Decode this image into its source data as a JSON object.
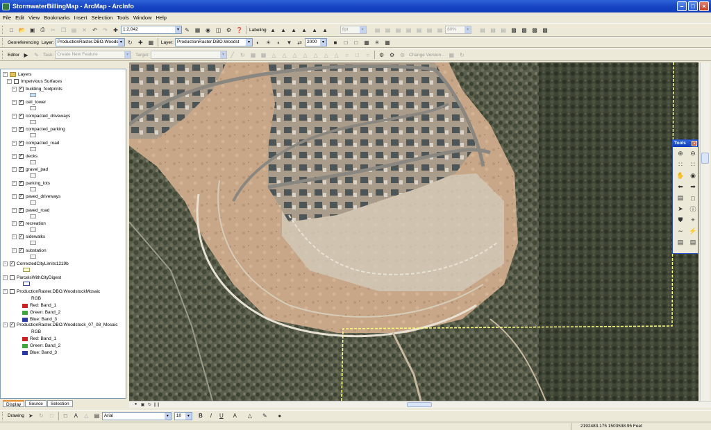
{
  "window": {
    "title": "StormwaterBillingMap - ArcMap - ArcInfo"
  },
  "menu": [
    "File",
    "Edit",
    "View",
    "Bookmarks",
    "Insert",
    "Selection",
    "Tools",
    "Window",
    "Help"
  ],
  "standard_toolbar": {
    "scale": "1:2,042",
    "labeling": "Labeling",
    "font_size": "8pt",
    "zoom": "80%"
  },
  "georef_toolbar": {
    "georeferencing": "Georeferencing",
    "layer_label": "Layer:",
    "layer_value": "ProductionRaster.DBO.Woodstock",
    "layer2_label": "Layer:",
    "layer2_value": "ProductionRaster.DBO.Woodst",
    "value": "2000"
  },
  "editor_toolbar": {
    "editor": "Editor",
    "task_label": "Task:",
    "task_value": "Create New Feature",
    "target_label": "Target:",
    "target_value": "",
    "change_version": "Change Version..."
  },
  "toc": {
    "root": "Layers",
    "group": "Impervious Surfaces",
    "layers": [
      "building_footprints",
      "cell_tower",
      "compacted_driveways",
      "compacted_parking",
      "compacted_road",
      "decks",
      "gravel_pad",
      "parking_lots",
      "paved_driveways",
      "paved_road",
      "recreation",
      "sidewalks",
      "substation"
    ],
    "corrected_limits": "CorrectedCityLimits1219b",
    "parcels": "ParcelsWithCityDigest",
    "raster1": "ProductionRaster.DBO.WoodstockMosaic",
    "raster2": "ProductionRaster.DBO.Woodstock_07_08_Mosaic",
    "rgb": "RGB",
    "bands": [
      {
        "label": "Red:",
        "band": "Band_1"
      },
      {
        "label": "Green:",
        "band": "Band_2"
      },
      {
        "label": "Blue:",
        "band": "Band_3"
      }
    ],
    "tabs": [
      "Display",
      "Source",
      "Selection"
    ]
  },
  "tools_window": {
    "title": "Tools"
  },
  "drawing_toolbar": {
    "drawing": "Drawing",
    "font": "Arial",
    "size": "10",
    "bold": "B",
    "italic": "I",
    "underline": "U"
  },
  "status": {
    "coordinates": "2192483.175  1503538.95 Feet"
  },
  "colors": {
    "red_band": "#d02020",
    "green_band": "#3ca83c",
    "blue_band": "#2a3aa8",
    "title_bar": "#0f3cb8",
    "city_limits": "#ffff80"
  }
}
